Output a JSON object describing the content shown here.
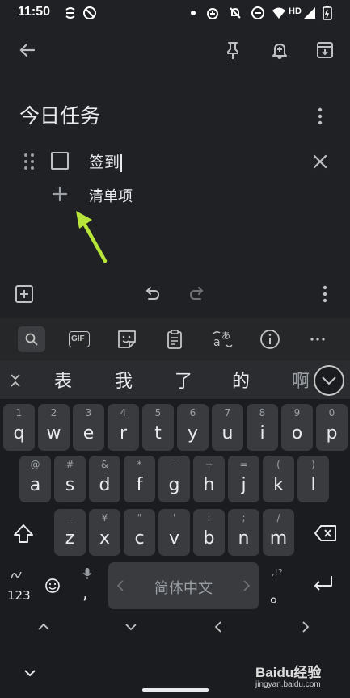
{
  "status_bar": {
    "time": "11:50",
    "icons": [
      "threads-icon",
      "no-disturb-icon",
      "dot-icon",
      "alarm-icon",
      "mute-icon",
      "minus-circle-icon",
      "wifi-icon",
      "hd-signal-icon",
      "battery-icon"
    ],
    "hd_label": "HD"
  },
  "toolbar": {
    "icons": [
      "back-arrow-icon",
      "pin-icon",
      "reminder-bell-icon",
      "archive-icon"
    ]
  },
  "note": {
    "title": "今日任务",
    "items": [
      {
        "text": "签到",
        "checked": false
      }
    ],
    "add_item_label": "清单项"
  },
  "editor_bar": {
    "icons": [
      "add-box-icon",
      "undo-icon",
      "redo-icon",
      "more-vert-icon"
    ]
  },
  "keyboard": {
    "toolbar_icons": [
      "search-icon",
      "gif-icon",
      "sticker-icon",
      "clipboard-icon",
      "translate-icon",
      "info-icon",
      "more-horiz-icon"
    ],
    "gif_label": "GIF",
    "candidates": [
      "表",
      "我",
      "了",
      "的",
      "啊"
    ],
    "rows": [
      [
        {
          "hint": "1",
          "key": "q"
        },
        {
          "hint": "2",
          "key": "w"
        },
        {
          "hint": "3",
          "key": "e"
        },
        {
          "hint": "4",
          "key": "r"
        },
        {
          "hint": "5",
          "key": "t"
        },
        {
          "hint": "6",
          "key": "y"
        },
        {
          "hint": "7",
          "key": "u"
        },
        {
          "hint": "8",
          "key": "i"
        },
        {
          "hint": "9",
          "key": "o"
        },
        {
          "hint": "0",
          "key": "p"
        }
      ],
      [
        {
          "hint": "@",
          "key": "a"
        },
        {
          "hint": "#",
          "key": "s"
        },
        {
          "hint": "&",
          "key": "d"
        },
        {
          "hint": "*",
          "key": "f"
        },
        {
          "hint": "-",
          "key": "g"
        },
        {
          "hint": "+",
          "key": "h"
        },
        {
          "hint": "=",
          "key": "j"
        },
        {
          "hint": "(",
          "key": "k"
        },
        {
          "hint": ")",
          "key": "l"
        }
      ],
      [
        {
          "hint": "_",
          "key": "z"
        },
        {
          "hint": "¥",
          "key": "x"
        },
        {
          "hint": "\"",
          "key": "c"
        },
        {
          "hint": "'",
          "key": "v"
        },
        {
          "hint": ":",
          "key": "b"
        },
        {
          "hint": ";",
          "key": "n"
        },
        {
          "hint": "/",
          "key": "m"
        }
      ]
    ],
    "num_key": "123",
    "comma_key": ",",
    "space_label": "简体中文",
    "period_key": "。",
    "period_hint": ",!?",
    "accent": "#b8e53a"
  },
  "watermark": {
    "brand": "Baidu经验",
    "url": "jingyan.baidu.com"
  }
}
